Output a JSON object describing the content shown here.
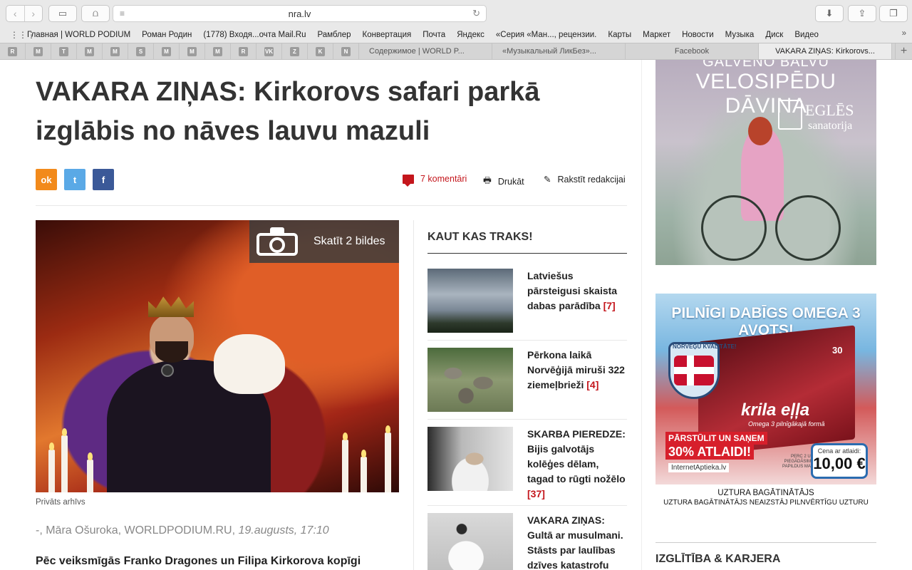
{
  "browser": {
    "url": "nra.lv",
    "bookmarks": [
      "Главная | WORLD PODIUM",
      "Роман Родин",
      "(1778) Входя...очта Mail.Ru",
      "Рамблер",
      "Конвертация",
      "Почта",
      "Яндекс",
      "«Серия «Ман..., рецензии.",
      "Карты",
      "Маркет",
      "Новости",
      "Музыка",
      "Диск",
      "Видео"
    ],
    "pinned_tabs": [
      "R",
      "M",
      "T",
      "M",
      "M",
      "S",
      "M",
      "M",
      "M",
      "R",
      "VK",
      "Z",
      "K",
      "N"
    ],
    "tabs": [
      "Содержимое | WORLD P...",
      "«Музыкальный ЛикБез»...",
      "Facebook",
      "VAKARA ZIŅAS: Kirkorovs..."
    ],
    "active_tab_index": 3
  },
  "article": {
    "title": "VAKARA ZIŅAS: Kirkorovs safari parkā izglābis no nāves lauvu mazuli",
    "comments": "7 komentāri",
    "print": "Drukāt",
    "write": "Rakstīt redakcijai",
    "photo_badge": "Skatīt 2 bildes",
    "caption": "Privāts arhīvs",
    "byline_authors": "-, Māra Ošuroka, WORLDPODIUM.RU, ",
    "byline_date": "19.augusts, 17:10",
    "lead": "Pēc veiksmīgās Franko Dragones un Filipa Kirkorova kopīgi"
  },
  "sidebar": {
    "title": "KAUT KAS TRAKS!",
    "items": [
      {
        "text": "Latviešus pārsteigusi skaista dabas parādība",
        "count": "[7]"
      },
      {
        "text": "Pērkona laikā Norvēģijā miruši 322 ziemeļbrieži",
        "count": "[4]"
      },
      {
        "text": "SKARBA PIEREDZE: Bijis galvotājs kolēģes dēlam, tagad to rūgti nožēlo",
        "count": "[37]"
      },
      {
        "text": "VAKARA ZIŅAS: Gultā ar musulmani. Stāsts par laulības dzīves katastrofu",
        "count": ""
      }
    ]
  },
  "ads": {
    "ad1": {
      "head1": "GALVENO BALVU",
      "head2": "VELOSIPĒDU DĀVINA",
      "logo1": "EGLĒS",
      "logo2": "sanatorija"
    },
    "ad2": {
      "head": "PILNĪGI DABĪGS OMEGA 3 AVOTS!",
      "badge": "NORVĒĢU KVALITĀTE!",
      "count": "30",
      "product": "krila eļļa",
      "product_sub": "Omega 3 pilnīgākajā formā",
      "discount1": "PĀRSTŪLIT UN SAŅEM",
      "discount2": "30% ATLAIDI!",
      "note": "PERC 2 UN PIEGĀDĀSIM BEZ PAPILDUS MAKSAS",
      "price_label": "Cena ar atlaidi:",
      "price": "10,00 €",
      "shop": "InternetAptieka.lv",
      "bottom1": "UZTURA BAGĀTINĀTĀJS",
      "bottom2": "UZTURA BAGĀTINĀTĀJS NEAIZSTĀJ PILNVĒRTĪGU UZTURU"
    }
  },
  "right_section": "IZGLĪTĪBA & KARJERA"
}
